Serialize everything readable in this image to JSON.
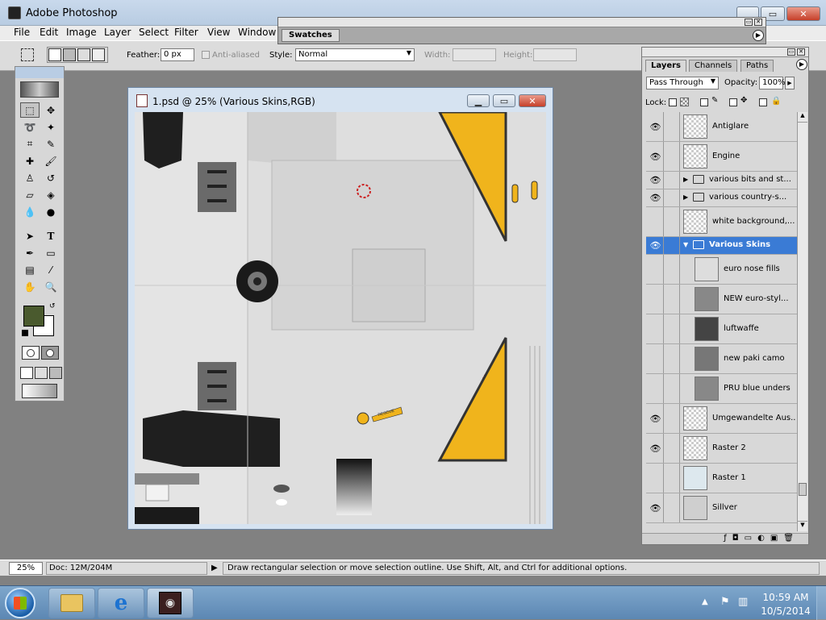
{
  "app": {
    "title": "Adobe Photoshop"
  },
  "menu": [
    "File",
    "Edit",
    "Image",
    "Layer",
    "Select",
    "Filter",
    "View",
    "Window"
  ],
  "swatches": {
    "title": "Swatches"
  },
  "options": {
    "feather_label": "Feather:",
    "feather_value": "0 px",
    "antialiased_label": "Anti-aliased",
    "style_label": "Style:",
    "style_value": "Normal",
    "width_label": "Width:",
    "height_label": "Height:"
  },
  "document": {
    "title": "1.psd @ 25% (Various Skins,RGB)",
    "rescue_label": "RESCUE"
  },
  "layers_panel": {
    "tabs": [
      "Layers",
      "Channels",
      "Paths"
    ],
    "blend_mode": "Pass Through",
    "opacity_label": "Opacity:",
    "opacity_value": "100%",
    "lock_label": "Lock:",
    "layers": [
      {
        "name": "Antiglare",
        "visible": true,
        "type": "layer"
      },
      {
        "name": "Engine",
        "visible": true,
        "type": "layer"
      },
      {
        "name": "various bits and st...",
        "visible": true,
        "type": "group"
      },
      {
        "name": "various country-s...",
        "visible": true,
        "type": "group"
      },
      {
        "name": "white background,...",
        "visible": false,
        "type": "layer"
      },
      {
        "name": "Various Skins",
        "visible": true,
        "type": "group-open",
        "selected": true
      },
      {
        "name": "euro nose fills",
        "visible": false,
        "type": "child"
      },
      {
        "name": "NEW euro-styl...",
        "visible": false,
        "type": "child"
      },
      {
        "name": "luftwaffe",
        "visible": false,
        "type": "child"
      },
      {
        "name": "new paki camo",
        "visible": false,
        "type": "child"
      },
      {
        "name": "PRU blue unders",
        "visible": false,
        "type": "child"
      },
      {
        "name": "Umgewandelte Aus...",
        "visible": true,
        "type": "layer"
      },
      {
        "name": "Raster 2",
        "visible": true,
        "type": "layer"
      },
      {
        "name": "Raster 1",
        "visible": false,
        "type": "layer"
      },
      {
        "name": "Sillver",
        "visible": true,
        "type": "layer"
      }
    ]
  },
  "status": {
    "zoom": "25%",
    "doc": "Doc: 12M/204M",
    "hint": "Draw rectangular selection or move selection outline.  Use Shift, Alt, and Ctrl for additional options."
  },
  "taskbar": {
    "time": "10:59 AM",
    "date": "10/5/2014"
  },
  "colors": {
    "foreground": "#4a5a2e",
    "accent_yellow": "#f0b41c",
    "selection": "#3a7bd5"
  }
}
